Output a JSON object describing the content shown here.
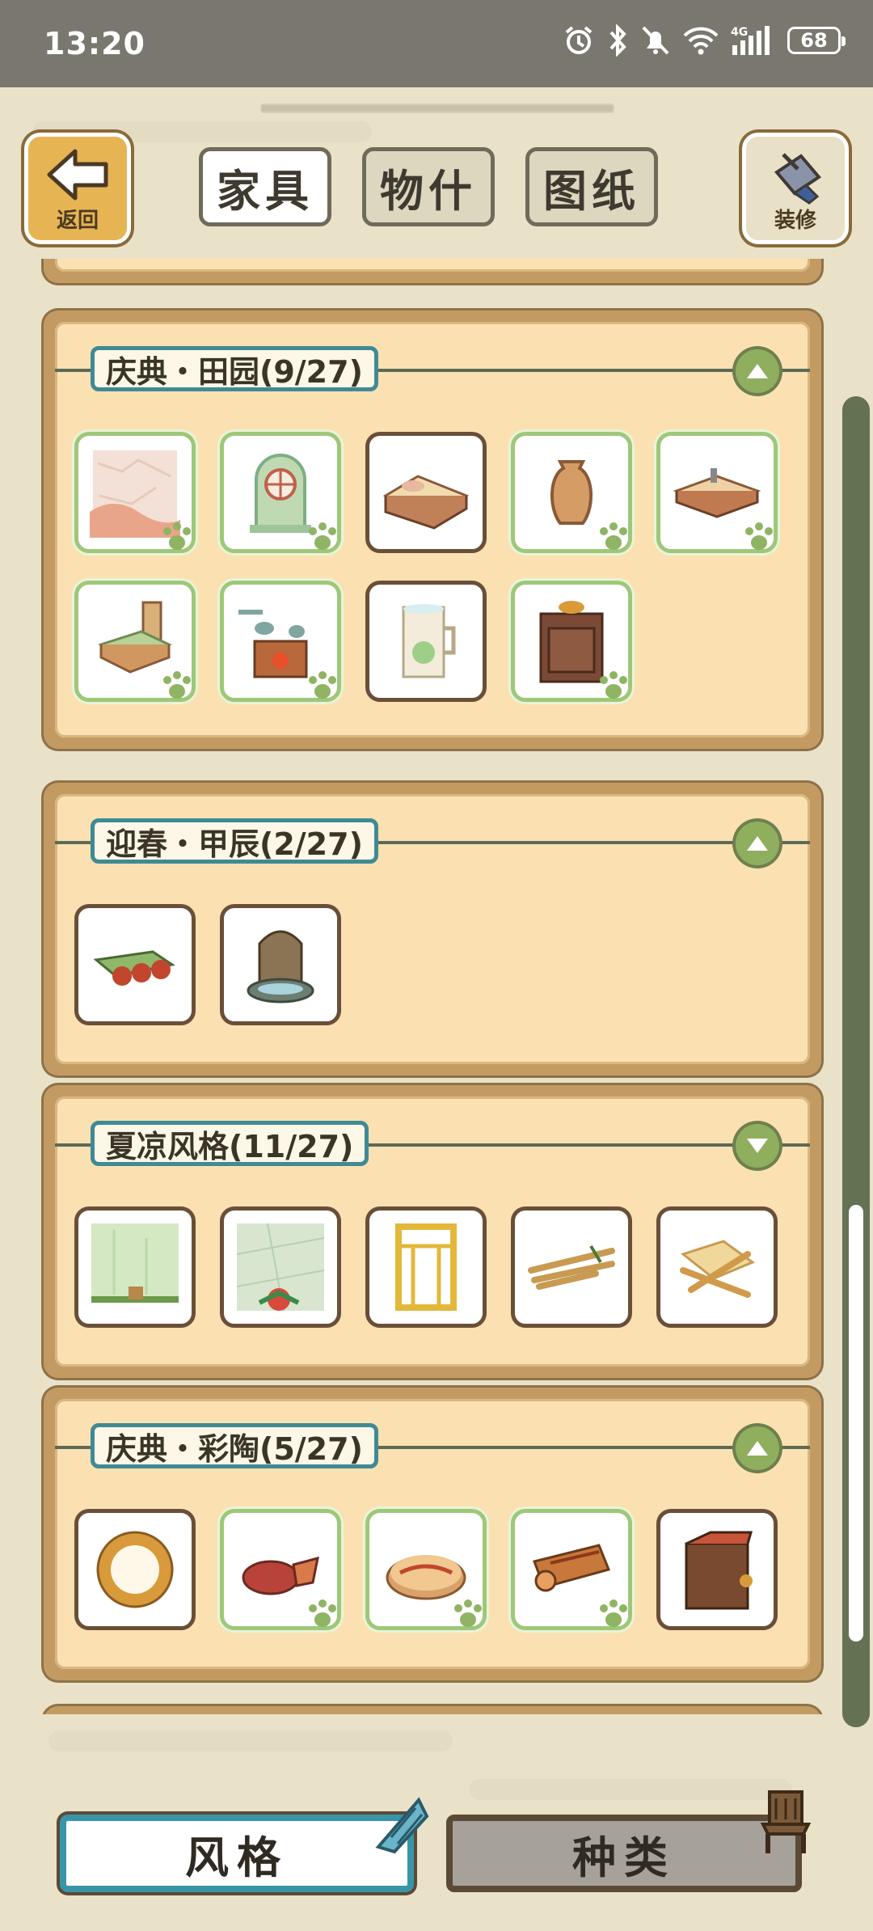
{
  "status_bar": {
    "time": "13:20",
    "icons": [
      "alarm-icon",
      "bluetooth-icon",
      "mute-icon",
      "wifi-icon",
      "4g-signal-icon"
    ],
    "battery": "68"
  },
  "header": {
    "back_label": "返回",
    "decor_label": "装修",
    "tabs": [
      {
        "label": "家具",
        "active": true
      },
      {
        "label": "物什",
        "active": false
      },
      {
        "label": "图纸",
        "active": false
      }
    ]
  },
  "sections": [
    {
      "title": "庆典・田园(9/27)",
      "expanded": true,
      "items": [
        "wallpaper",
        "arched-window",
        "bed",
        "vase",
        "low-table",
        "chair",
        "tea-stove",
        "mug",
        "cabinet"
      ],
      "paw_marked": [
        0,
        1,
        3,
        4,
        5,
        6,
        8
      ]
    },
    {
      "title": "迎春・甲辰(2/27)",
      "expanded": true,
      "items": [
        "scroll-rug",
        "stone-fountain"
      ],
      "paw_marked": []
    },
    {
      "title": "夏凉风格(11/27)",
      "expanded": false,
      "items": [
        "bamboo-wall",
        "tile-floor",
        "bamboo-door",
        "bamboo-sticks",
        "bamboo-stool"
      ],
      "paw_marked": []
    },
    {
      "title": "庆典・彩陶(5/27)",
      "expanded": true,
      "items": [
        "flower-ring",
        "cloth-bundle",
        "round-rug",
        "rolled-rug",
        "pottery-cabinet"
      ],
      "paw_marked": [
        1,
        2,
        3
      ]
    }
  ],
  "bottom_tabs": [
    {
      "label": "风格",
      "active": true
    },
    {
      "label": "种类",
      "active": false
    }
  ],
  "colors": {
    "background": "#e9e2c9",
    "card_frame": "#c39b62",
    "card_fill": "#fbe1b2",
    "title_border": "#3f8a95",
    "toggle_green": "#8fae5e",
    "owned_border": "#6a4f38",
    "marked_border": "#9fc779",
    "active_tab_border": "#3895a8"
  }
}
